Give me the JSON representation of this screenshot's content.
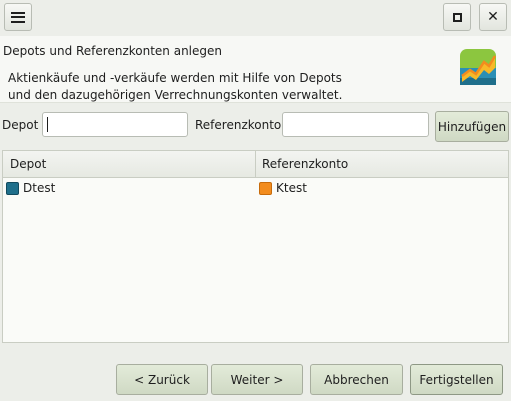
{
  "window": {
    "menu_icon": "hamburger-icon",
    "maximize_icon": "maximize-icon",
    "close_icon": "close-icon",
    "close_glyph": "✕"
  },
  "header": {
    "title": "Depots und Referenzkonten anlegen",
    "description_line1": "Aktienkäufe und -verkäufe werden mit Hilfe von Depots",
    "description_line2": "und den dazugehörigen Verrechnungskonten verwaltet.",
    "logo_icon": "chart-logo-icon"
  },
  "form": {
    "depot_label": "Depot",
    "depot_value": "",
    "referenzkonto_label": "Referenzkonto",
    "referenzkonto_value": "",
    "add_button": "Hinzufügen"
  },
  "table": {
    "columns": [
      "Depot",
      "Referenzkonto"
    ],
    "rows": [
      {
        "depot": "Dtest",
        "referenzkonto": "Ktest"
      }
    ],
    "colors": {
      "depot": "#1f6f8b",
      "referenzkonto": "#f28c1e"
    }
  },
  "navigation": {
    "back": "< Zurück",
    "next": "Weiter >",
    "cancel": "Abbrechen",
    "finish": "Fertigstellen"
  }
}
